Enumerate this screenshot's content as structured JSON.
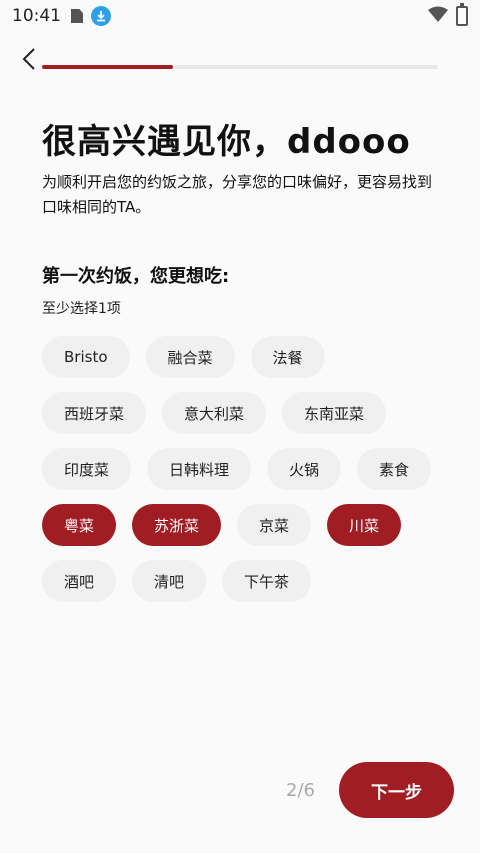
{
  "status_bar": {
    "time": "10:41"
  },
  "progress": {
    "fraction": 0.33
  },
  "header": {
    "title": "很高兴遇见你，ddooo",
    "description": "为顺利开启您的约饭之旅，分享您的口味偏好，更容易找到口味相同的TA。"
  },
  "question": {
    "title": "第一次约饭，您更想吃:",
    "hint": "至少选择1项"
  },
  "options": [
    [
      {
        "label": "Bristo",
        "selected": false
      },
      {
        "label": "融合菜",
        "selected": false
      },
      {
        "label": "法餐",
        "selected": false
      }
    ],
    [
      {
        "label": "西班牙菜",
        "selected": false
      },
      {
        "label": "意大利菜",
        "selected": false
      },
      {
        "label": "东南亚菜",
        "selected": false
      }
    ],
    [
      {
        "label": "印度菜",
        "selected": false
      },
      {
        "label": "日韩料理",
        "selected": false
      },
      {
        "label": "火锅",
        "selected": false
      },
      {
        "label": "素食",
        "selected": false
      }
    ],
    [
      {
        "label": "粤菜",
        "selected": true
      },
      {
        "label": "苏浙菜",
        "selected": true
      },
      {
        "label": "京菜",
        "selected": false
      },
      {
        "label": "川菜",
        "selected": true
      }
    ],
    [
      {
        "label": "酒吧",
        "selected": false
      },
      {
        "label": "清吧",
        "selected": false
      },
      {
        "label": "下午茶",
        "selected": false
      }
    ]
  ],
  "footer": {
    "step": "2/6",
    "next_label": "下一步"
  },
  "colors": {
    "accent": "#a01d24",
    "chip_bg": "#f0f0f0",
    "background": "#fafafa"
  }
}
